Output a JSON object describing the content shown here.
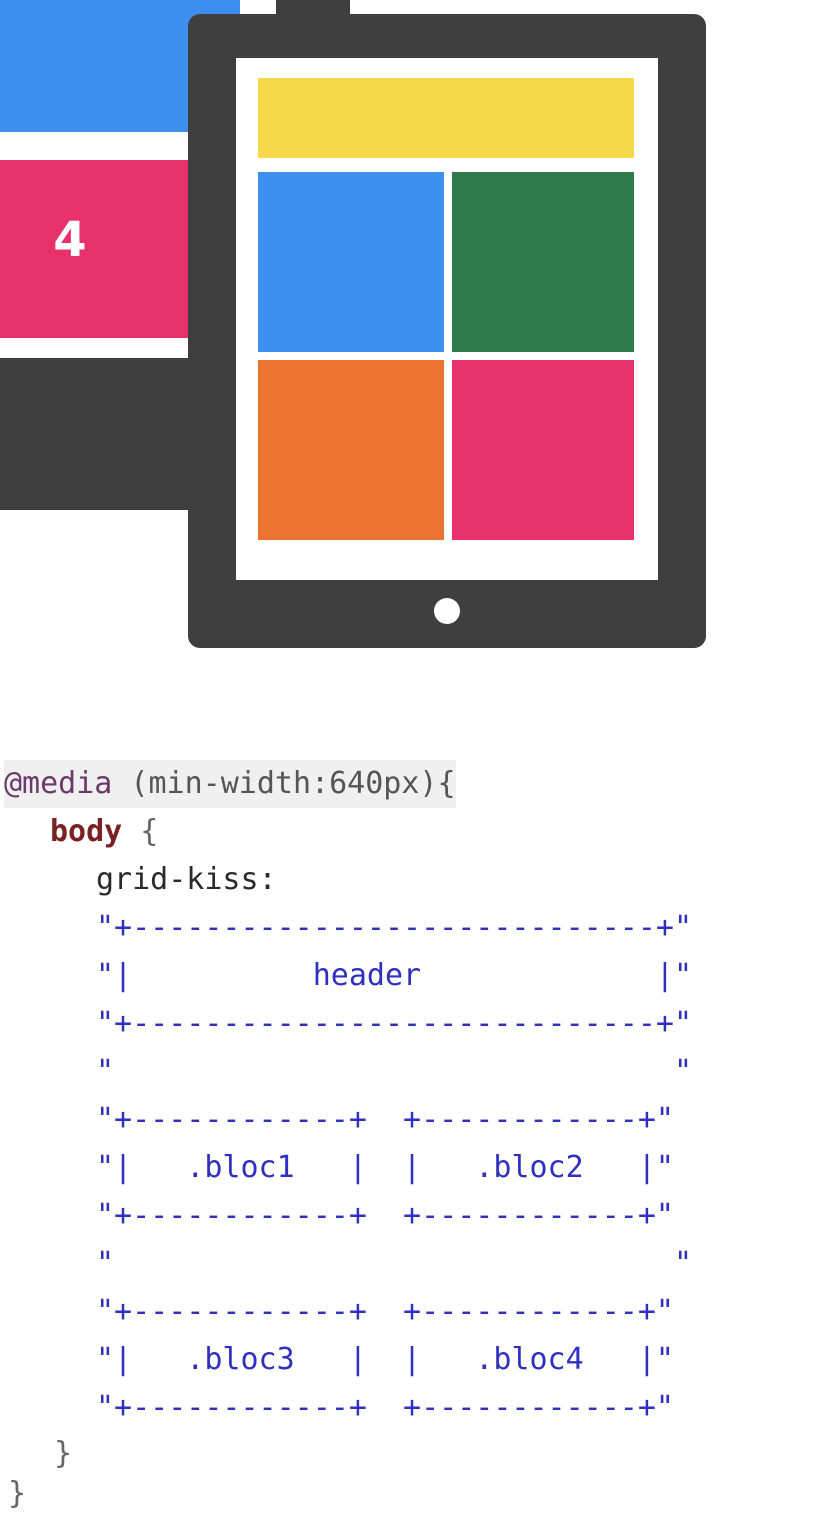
{
  "illustration": {
    "desktop_tile_label": "4",
    "colors": {
      "device": "#3f3f3f",
      "yellow": "#f7d84a",
      "blue": "#3f8ff0",
      "green": "#2f7a4a",
      "orange": "#ec7430",
      "pink": "#e8306a"
    }
  },
  "code": {
    "media_at": "@media",
    "media_query": " (min-width:640px){",
    "selector": "body",
    "selector_brace": " {",
    "property": "grid-kiss:",
    "ascii_lines": [
      "\"+-----------------------------+\"",
      "\"|          header             |\"",
      "\"+-----------------------------+\"",
      "\"                               \"",
      "\"+------------+  +------------+\"",
      "\"|   .bloc1   |  |   .bloc2   |\"",
      "\"+------------+  +------------+\"",
      "\"                               \"",
      "\"+------------+  +------------+\"",
      "\"|   .bloc3   |  |   .bloc4   |\"",
      "\"+------------+  +------------+\""
    ],
    "close_body": "}",
    "close_media": "}"
  }
}
